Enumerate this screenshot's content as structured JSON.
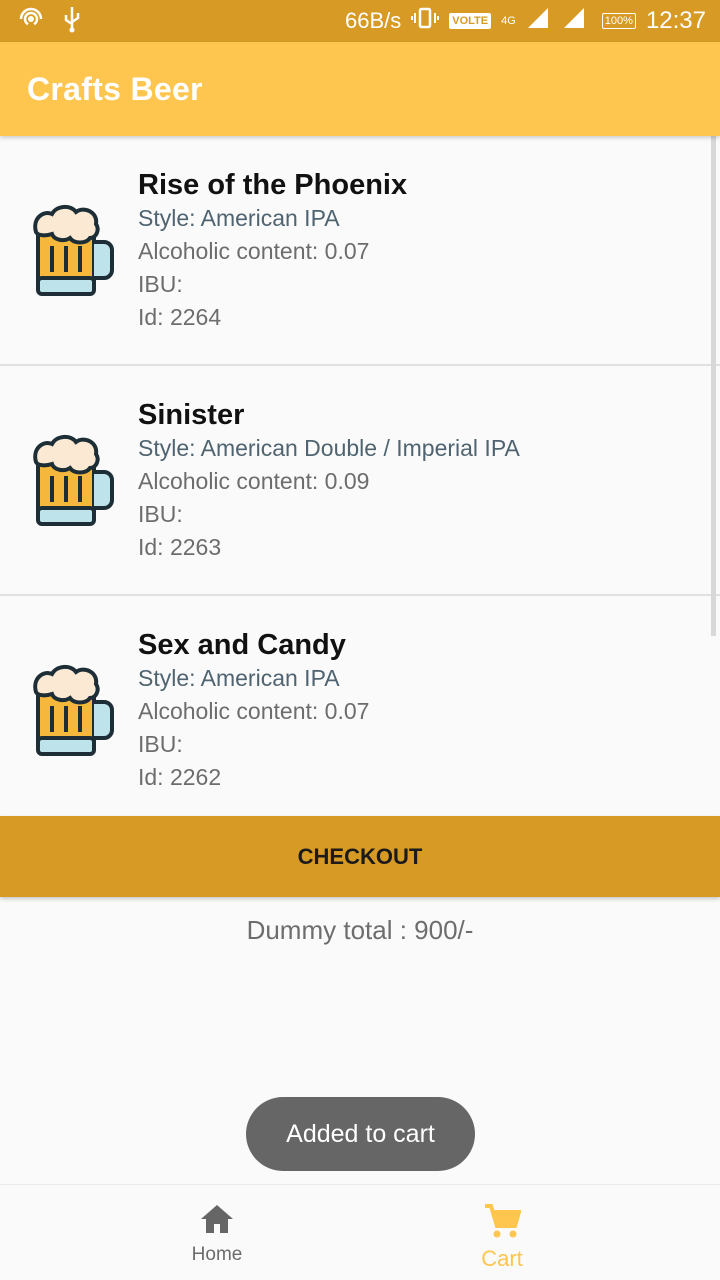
{
  "status_bar": {
    "speed": "66B/s",
    "volte": "VOLTE",
    "network": "4G",
    "battery": "100%",
    "time": "12:37",
    "icons": [
      "hotspot-icon",
      "usb-icon",
      "vibrate-icon",
      "signal-icon",
      "signal-icon"
    ]
  },
  "app_bar": {
    "title": "Crafts Beer"
  },
  "beers": [
    {
      "name": "Rise of the Phoenix",
      "style": "Style: American IPA",
      "abv": "Alcoholic content: 0.07",
      "ibu": "IBU:",
      "id": "Id: 2264"
    },
    {
      "name": "Sinister",
      "style": "Style: American Double / Imperial IPA",
      "abv": "Alcoholic content: 0.09",
      "ibu": "IBU:",
      "id": "Id: 2263"
    },
    {
      "name": "Sex and Candy",
      "style": "Style: American IPA",
      "abv": "Alcoholic content: 0.07",
      "ibu": "IBU:",
      "id": "Id: 2262"
    }
  ],
  "checkout": {
    "label": "CHECKOUT"
  },
  "total": {
    "text": "Dummy total : 900/-"
  },
  "toast": {
    "text": "Added to cart"
  },
  "bottom_nav": {
    "home": {
      "label": "Home",
      "icon": "home-icon"
    },
    "cart": {
      "label": "Cart",
      "icon": "cart-icon"
    }
  },
  "colors": {
    "status_bar": "#d79b25",
    "app_bar": "#fec54f",
    "checkout": "#d79b25",
    "accent": "#fec54f"
  }
}
